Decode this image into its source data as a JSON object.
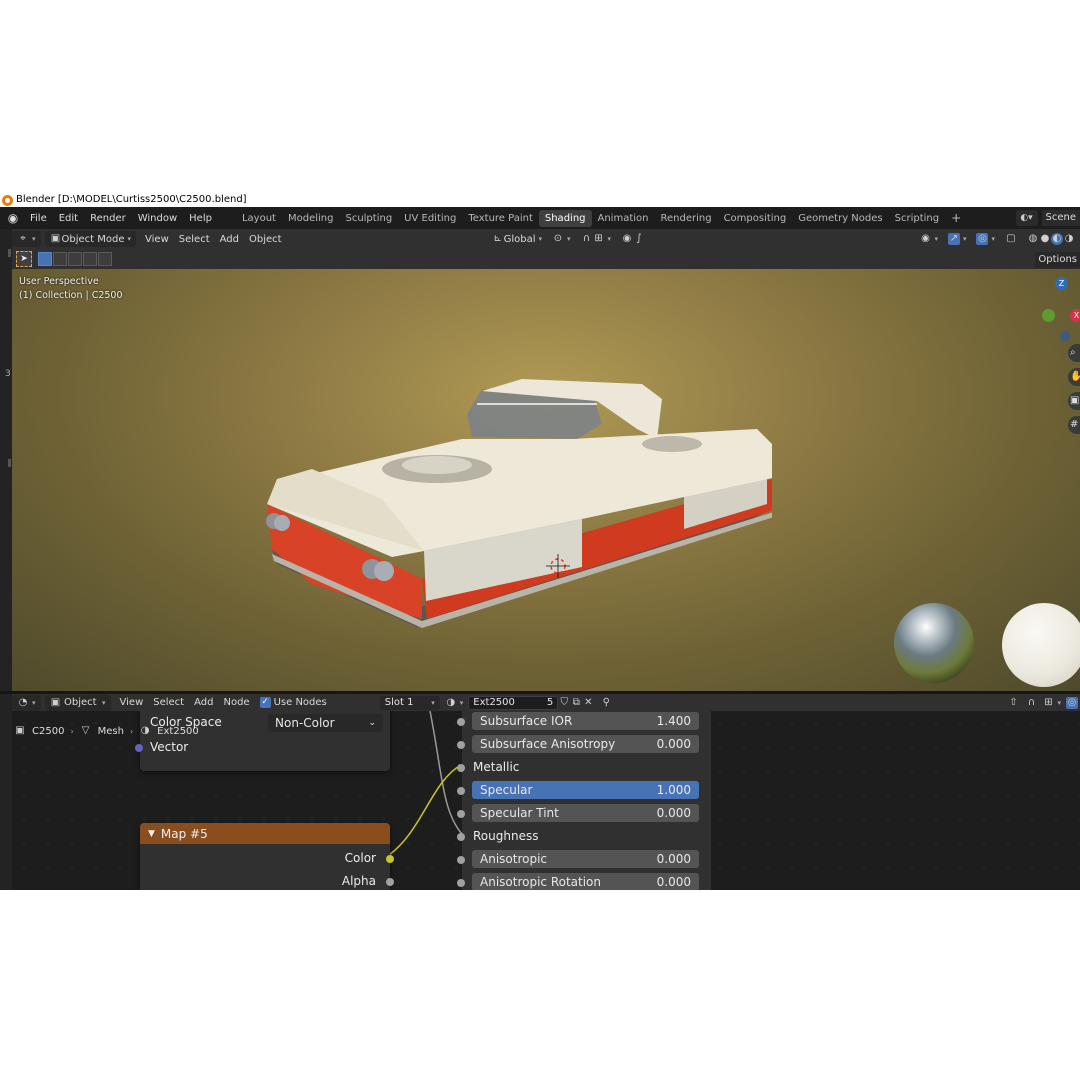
{
  "window": {
    "title": "Blender [D:\\MODEL\\Curtiss2500\\C2500.blend]"
  },
  "menu": {
    "items": [
      "File",
      "Edit",
      "Render",
      "Window",
      "Help"
    ],
    "workspaces": [
      "Layout",
      "Modeling",
      "Sculpting",
      "UV Editing",
      "Texture Paint",
      "Shading",
      "Animation",
      "Rendering",
      "Compositing",
      "Geometry Nodes",
      "Scripting"
    ],
    "active_workspace": "Shading",
    "add_workspace": "+",
    "scene_label": "Scene"
  },
  "viewport_header": {
    "mode": "Object Mode",
    "menus": [
      "View",
      "Select",
      "Add",
      "Object"
    ],
    "orientation": "Global"
  },
  "toolbar": {
    "options_label": "Options"
  },
  "viewport": {
    "perspective": "User Perspective",
    "collection": "(1) Collection | C2500",
    "side_number": "3",
    "gizmo": {
      "z": "Z",
      "x": "X"
    }
  },
  "node_header": {
    "editor_type": "Object",
    "menus": [
      "View",
      "Select",
      "Add",
      "Node"
    ],
    "use_nodes_label": "Use Nodes",
    "slot": "Slot 1",
    "material": "Ext2500",
    "users": "5"
  },
  "node_editor": {
    "breadcrumb": [
      "C2500",
      "Mesh",
      "Ext2500"
    ],
    "image_node": {
      "color_space_label": "Color Space",
      "color_space_value": "Non-Color",
      "vector_label": "Vector"
    },
    "map_node": {
      "title": "Map #5",
      "outputs": [
        "Color",
        "Alpha"
      ]
    },
    "bsdf_fields": [
      {
        "label": "Subsurface IOR",
        "value": "1.400",
        "highlight": false
      },
      {
        "label": "Subsurface Anisotropy",
        "value": "0.000",
        "highlight": false
      },
      {
        "label": "Metallic",
        "value": "",
        "highlight": false,
        "socket_only": true
      },
      {
        "label": "Specular",
        "value": "1.000",
        "highlight": true
      },
      {
        "label": "Specular Tint",
        "value": "0.000",
        "highlight": false
      },
      {
        "label": "Roughness",
        "value": "",
        "highlight": false,
        "socket_only": true
      },
      {
        "label": "Anisotropic",
        "value": "0.000",
        "highlight": false
      },
      {
        "label": "Anisotropic Rotation",
        "value": "0.000",
        "highlight": false
      }
    ]
  },
  "colors": {
    "accent_blue": "#4772b3",
    "map_header": "#8a4d1e",
    "socket_yellow": "#c7c729",
    "socket_purple": "#6363c7",
    "socket_grey": "#a1a1a1"
  }
}
